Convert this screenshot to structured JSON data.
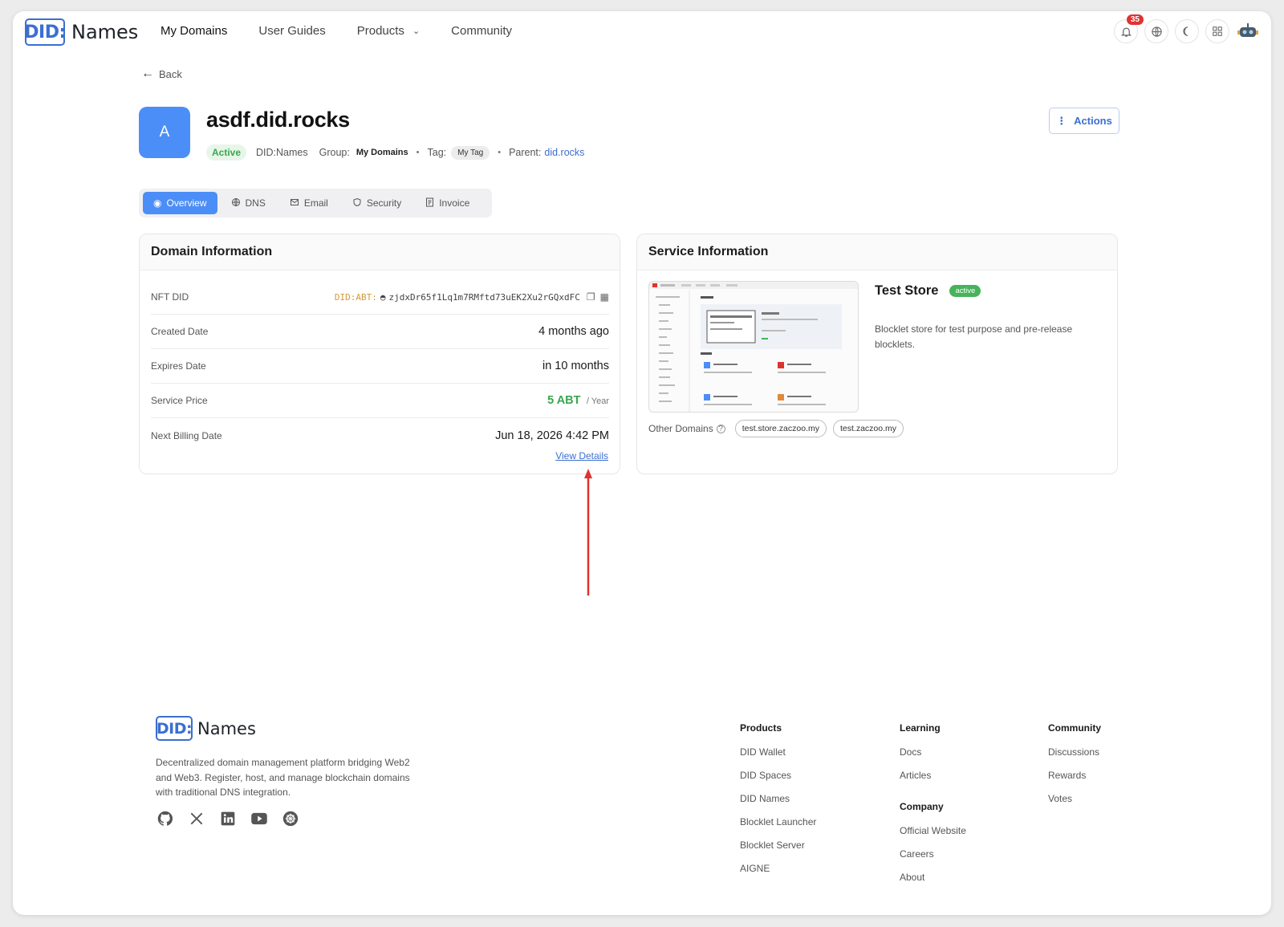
{
  "header": {
    "logo_mark": "DID:",
    "logo_text": "Names",
    "nav": [
      {
        "label": "My Domains"
      },
      {
        "label": "User Guides"
      },
      {
        "label": "Products"
      },
      {
        "label": "Community"
      }
    ],
    "notification_count": "35",
    "icons": [
      "bell-icon",
      "globe-icon",
      "moon-icon",
      "apps-icon",
      "robot-avatar-icon"
    ]
  },
  "back_label": "Back",
  "domain": {
    "avatar_letter": "A",
    "name": "asdf.did.rocks",
    "status": "Active",
    "provider": "DID:Names",
    "group_label": "Group:",
    "group_value": "My Domains",
    "tag_label": "Tag:",
    "tag_value": "My Tag",
    "parent_label": "Parent:",
    "parent_value": "did.rocks",
    "actions_label": "Actions"
  },
  "tabs": [
    {
      "label": "Overview",
      "icon": "overview-icon",
      "active": true
    },
    {
      "label": "DNS",
      "icon": "globe-icon"
    },
    {
      "label": "Email",
      "icon": "mail-icon"
    },
    {
      "label": "Security",
      "icon": "shield-icon"
    },
    {
      "label": "Invoice",
      "icon": "invoice-icon"
    }
  ],
  "domain_info": {
    "title": "Domain Information",
    "nft_did_label": "NFT DID",
    "nft_did_prefix": "DID:ABT:",
    "nft_did_value": "zjdxDr65f1Lq1m7RMftd73uEK2Xu2rGQxdFC",
    "created_label": "Created Date",
    "created_value": "4 months ago",
    "expires_label": "Expires Date",
    "expires_value": "in 10 months",
    "price_label": "Service Price",
    "price_value": "5 ABT",
    "price_unit": "/ Year",
    "billing_label": "Next Billing Date",
    "billing_value": "Jun 18, 2026 4:42 PM",
    "view_details": "View Details"
  },
  "service_info": {
    "title": "Service Information",
    "store_name": "Test Store",
    "store_status": "active",
    "store_desc": "Blocklet store for test purpose and pre-release blocklets.",
    "other_domains_label": "Other Domains",
    "other_domains": [
      "test.store.zaczoo.my",
      "test.zaczoo.my"
    ]
  },
  "footer": {
    "logo_mark": "DID:",
    "logo_text": "Names",
    "description": "Decentralized domain management platform bridging Web2 and Web3. Register, host, and manage blockchain domains with traditional DNS integration.",
    "socials": [
      "github-icon",
      "x-icon",
      "linkedin-icon",
      "youtube-icon",
      "community-icon"
    ],
    "products": {
      "heading": "Products",
      "links": [
        "DID Wallet",
        "DID Spaces",
        "DID Names",
        "Blocklet Launcher",
        "Blocklet Server",
        "AIGNE"
      ]
    },
    "learning": {
      "heading": "Learning",
      "links": [
        "Docs",
        "Articles"
      ]
    },
    "company": {
      "heading": "Company",
      "links": [
        "Official Website",
        "Careers",
        "About"
      ]
    },
    "community": {
      "heading": "Community",
      "links": [
        "Discussions",
        "Rewards",
        "Votes"
      ]
    }
  },
  "colors": {
    "brand": "#3b6fd1",
    "accent_blue": "#4c8ef7",
    "success": "#3aa650",
    "annotation_arrow": "#e0322f"
  }
}
